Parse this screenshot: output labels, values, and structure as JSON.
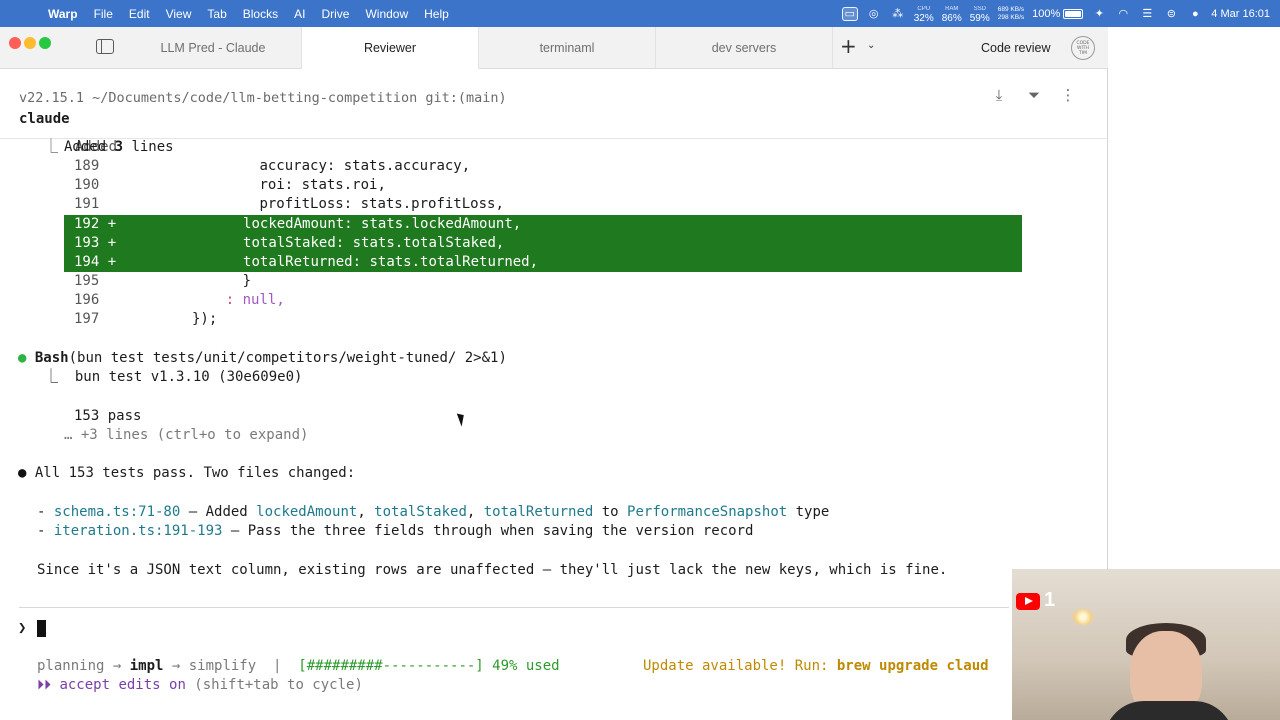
{
  "menubar": {
    "app": "Warp",
    "menus": [
      "File",
      "Edit",
      "View",
      "Tab",
      "Blocks",
      "AI",
      "Drive",
      "Window",
      "Help"
    ],
    "cpu_label": "CPU",
    "cpu": "32%",
    "ram_label": "RAM",
    "ram": "86%",
    "ssd_label": "SSD",
    "ssd": "59%",
    "net_up": "689 KB/s",
    "net_down": "298 KB/s",
    "battery": "100%",
    "datetime": "4 Mar  16:01"
  },
  "tabs": [
    {
      "label": "LLM Pred - Claude"
    },
    {
      "label": "Reviewer"
    },
    {
      "label": "terminaml"
    },
    {
      "label": "dev servers"
    }
  ],
  "active_tab": "Reviewer",
  "toolbar": {
    "code_review": "Code review",
    "badge_top": "CODE",
    "badge_mid": "WITH",
    "badge_bot": "TIM"
  },
  "header": {
    "cwd": "v22.15.1 ~/Documents/code/llm-betting-competition git:(main)",
    "command": "claude"
  },
  "output": {
    "added_prefix": "⎿  Added ",
    "added_count": "3",
    "added_suffix": " lines",
    "diff": [
      {
        "n": "189",
        "mark": "",
        "code": "                accuracy: stats.accuracy,"
      },
      {
        "n": "190",
        "mark": "",
        "code": "                roi: stats.roi,"
      },
      {
        "n": "191",
        "mark": "",
        "code": "                profitLoss: stats.profitLoss,"
      },
      {
        "n": "192",
        "mark": "+",
        "code": "                lockedAmount: stats.lockedAmount,"
      },
      {
        "n": "193",
        "mark": "+",
        "code": "                totalStaked: stats.totalStaked,"
      },
      {
        "n": "194",
        "mark": "+",
        "code": "                totalReturned: stats.totalReturned,"
      },
      {
        "n": "195",
        "mark": "",
        "code": "              }"
      },
      {
        "n": "196",
        "mark": "",
        "code_prefix": "            ",
        "colon": ":",
        "code": " null,"
      },
      {
        "n": "197",
        "mark": "",
        "code": "        });"
      }
    ],
    "bash_dot": "●",
    "bash_label": "Bash",
    "bash_cmd": "(bun test tests/unit/competitors/weight-tuned/ 2>&1)",
    "bash_result": "⎿  bun test v1.3.10 (30e609e0)",
    "pass_line": "153 pass",
    "more_lines": "… +3 lines (ctrl+o to expand)",
    "summary": "All 153 tests pass. Two files changed:",
    "file1_link": "schema.ts:71-80",
    "file1_a": " — Added ",
    "file1_f1": "lockedAmount",
    "file1_c1": ", ",
    "file1_f2": "totalStaked",
    "file1_c2": ", ",
    "file1_f3": "totalReturned",
    "file1_to": " to ",
    "file1_type": "PerformanceSnapshot",
    "file1_end": " type",
    "file2_link": "iteration.ts:191-193",
    "file2_text": " — Pass the three fields through when saving the version record",
    "closing": "Since it's a JSON text column, existing rows are unaffected — they'll just lack the new keys, which is fine."
  },
  "prompt": {
    "chevron": "❯"
  },
  "status": {
    "modes_pre": "planning → ",
    "mode_active": "impl",
    "modes_post": " → simplify  |  ",
    "progress": "[#########-----------] 49% used",
    "progress_value": 0.49,
    "update_prefix": "Update available! Run: ",
    "update_cmd": "brew upgrade claud",
    "accept_prefix": "⏵⏵ ",
    "accept": "accept edits on",
    "accept_hint": " (shift+tab to cycle)"
  },
  "webcam": {
    "yt_count": "1"
  },
  "colors": {
    "diff_add_bg": "#1f7a1f",
    "menubar": "#3b74c9",
    "link": "#1e7a8c",
    "update": "#c08a00"
  }
}
